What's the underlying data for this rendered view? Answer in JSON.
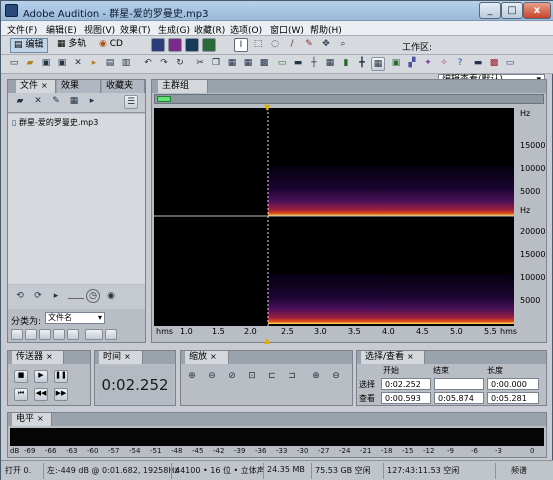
{
  "window": {
    "title": "Adobe Audition - 群星-爱的罗曼史.mp3",
    "buttons": [
      "_",
      "□",
      "x"
    ]
  },
  "menu": [
    "文件(F)",
    "编辑(E)",
    "视图(V)",
    "效果(T)",
    "生成(G)",
    "收藏(R)",
    "选项(O)",
    "窗口(W)",
    "帮助(H)"
  ],
  "modes": [
    {
      "label": "编辑",
      "active": true
    },
    {
      "label": "多轨"
    },
    {
      "label": "CD"
    }
  ],
  "workspace": {
    "label": "工作区:",
    "value": "编辑查看(默认)"
  },
  "files_panel": {
    "tabs": [
      "文件",
      "效果",
      "收藏夹"
    ],
    "items": [
      "群星-爱的罗曼史.mp3"
    ],
    "sort_label": "分类为:",
    "sort_value": "文件名"
  },
  "main_group": {
    "tab": "主群组"
  },
  "spectrogram": {
    "unit": "Hz",
    "freq_ticks": [
      "15000",
      "10000",
      "5000",
      "20000",
      "15000",
      "10000",
      "5000"
    ],
    "time_ticks": [
      "hms",
      "1.0",
      "1.5",
      "2.0",
      "2.5",
      "3.0",
      "3.5",
      "4.0",
      "4.5",
      "5.0",
      "5.5",
      "hms"
    ]
  },
  "transport": {
    "tab": "传送器"
  },
  "time_panel": {
    "tab": "时间",
    "value": "0:02.252"
  },
  "zoom_panel": {
    "tab": "缩放"
  },
  "selection_panel": {
    "tab": "选择/查看",
    "headers": [
      "开始",
      "结束",
      "长度"
    ],
    "rows": [
      {
        "label": "选择",
        "start": "0:02.252",
        "end": "",
        "length": "0:00.000"
      },
      {
        "label": "查看",
        "start": "0:00.593",
        "end": "0:05.874",
        "length": "0:05.281"
      }
    ]
  },
  "level_panel": {
    "tab": "电平",
    "ticks": [
      "dB",
      "-69",
      "-66",
      "-63",
      "-60",
      "-57",
      "-54",
      "-51",
      "-48",
      "-45",
      "-42",
      "-39",
      "-36",
      "-33",
      "-30",
      "-27",
      "-24",
      "-21",
      "-18",
      "-15",
      "-12",
      "-9",
      "-6",
      "-3",
      "0"
    ]
  },
  "status": {
    "open": "打开 0.",
    "cursor": "左:-449 dB @ 0:01.682, 19258Hz",
    "format": "44100 • 16 位 • 立体声",
    "size": "24.35 MB",
    "free": "75.53 GB 空闲",
    "time_free": "127:43:11.53 空闲",
    "view": "频谱"
  },
  "colors": {
    "spectro_hot": "#ffee66",
    "spectro_mid": "#e04010",
    "spectro_low": "#502060",
    "accent_blue": "#2b4a7a"
  }
}
